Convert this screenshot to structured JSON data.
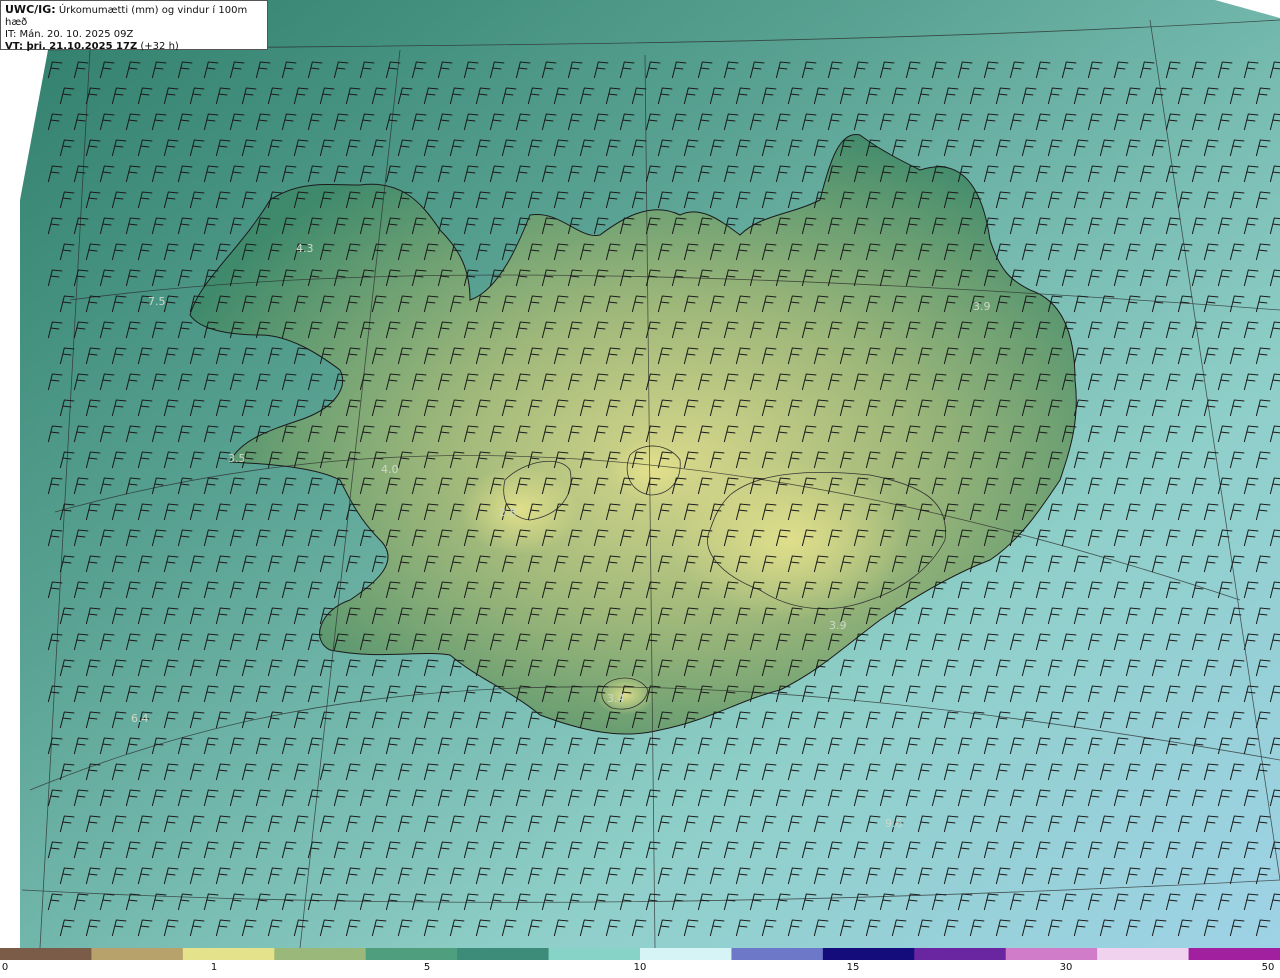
{
  "info": {
    "title": "UWC/IG:",
    "subtitle": " Úrkomumætti (mm) og vindur í 100m hæð",
    "it": "IT: Mán. 20. 10. 2025 09Z",
    "vt_label": "VT:",
    "vt_value": " þri. 21.10.2025 17Z",
    "vt_suffix": " (+32 h)"
  },
  "map_values": [
    "4.3",
    "7.5",
    "3.9",
    "3.5",
    "4.0",
    "2.8",
    "3.9",
    "6.4",
    "3.4",
    "9.6"
  ],
  "colorbar": {
    "ticks": [
      "0",
      "1",
      "5",
      "10",
      "15",
      "30",
      "50"
    ],
    "colors": [
      "#7a5c49",
      "#b8a26c",
      "#e5e28c",
      "#9ab87a",
      "#4f9e7d",
      "#3d8b79",
      "#88d3c8",
      "#d6f4f6",
      "#6d78c8",
      "#140c7a",
      "#6a26a0",
      "#d07cc8",
      "#f1d2ee",
      "#a020a0"
    ]
  }
}
